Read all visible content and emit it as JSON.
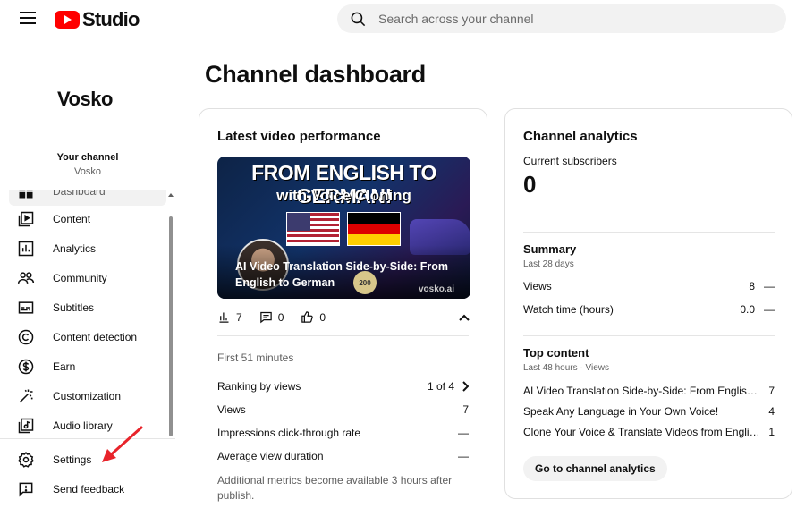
{
  "header": {
    "logo_text": "Studio",
    "search_placeholder": "Search across your channel"
  },
  "sidebar": {
    "brand": "Vosko",
    "your_channel_label": "Your channel",
    "channel_name": "Vosko",
    "items": [
      {
        "label": "Dashboard",
        "icon": "dashboard-icon"
      },
      {
        "label": "Content",
        "icon": "content-icon"
      },
      {
        "label": "Analytics",
        "icon": "analytics-icon"
      },
      {
        "label": "Community",
        "icon": "community-icon"
      },
      {
        "label": "Subtitles",
        "icon": "subtitles-icon"
      },
      {
        "label": "Content detection",
        "icon": "copyright-icon"
      },
      {
        "label": "Earn",
        "icon": "dollar-icon"
      },
      {
        "label": "Customization",
        "icon": "magic-wand-icon"
      },
      {
        "label": "Audio library",
        "icon": "audio-library-icon"
      }
    ],
    "bottom": [
      {
        "label": "Settings",
        "icon": "gear-icon"
      },
      {
        "label": "Send feedback",
        "icon": "feedback-icon"
      }
    ],
    "annotation_color": "#e8242b"
  },
  "main": {
    "title": "Channel dashboard",
    "latest": {
      "title": "Latest video performance",
      "thumbnail": {
        "headline": "FROM ENGLISH TO GERMAN!",
        "subline": "with Voice Cloning",
        "video_title": "AI Video Translation Side-by-Side: From English to German",
        "badge": "200",
        "watermark": "vosko.ai"
      },
      "views": "7",
      "comments": "0",
      "likes": "0",
      "period": "First 51 minutes",
      "ranking_label": "Ranking by views",
      "ranking_value": "1 of 4",
      "metrics": [
        {
          "label": "Views",
          "value": "7"
        },
        {
          "label": "Impressions click-through rate",
          "value": "—"
        },
        {
          "label": "Average view duration",
          "value": "—"
        }
      ],
      "note": "Additional metrics become available 3 hours after publish."
    },
    "analytics": {
      "title": "Channel analytics",
      "subscribers_label": "Current subscribers",
      "subscribers_value": "0",
      "summary_title": "Summary",
      "summary_period": "Last 28 days",
      "summary_rows": [
        {
          "label": "Views",
          "value": "8",
          "trend": "—"
        },
        {
          "label": "Watch time (hours)",
          "value": "0.0",
          "trend": "—"
        }
      ],
      "top_title": "Top content",
      "top_period": "Last 48 hours · Views",
      "top_rows": [
        {
          "title": "AI Video Translation Side-by-Side: From English to German",
          "views": "7"
        },
        {
          "title": "Speak Any Language in Your Own Voice!",
          "views": "4"
        },
        {
          "title": "Clone Your Voice & Translate Videos from English to German",
          "views": "1"
        }
      ],
      "button_label": "Go to channel analytics"
    }
  }
}
